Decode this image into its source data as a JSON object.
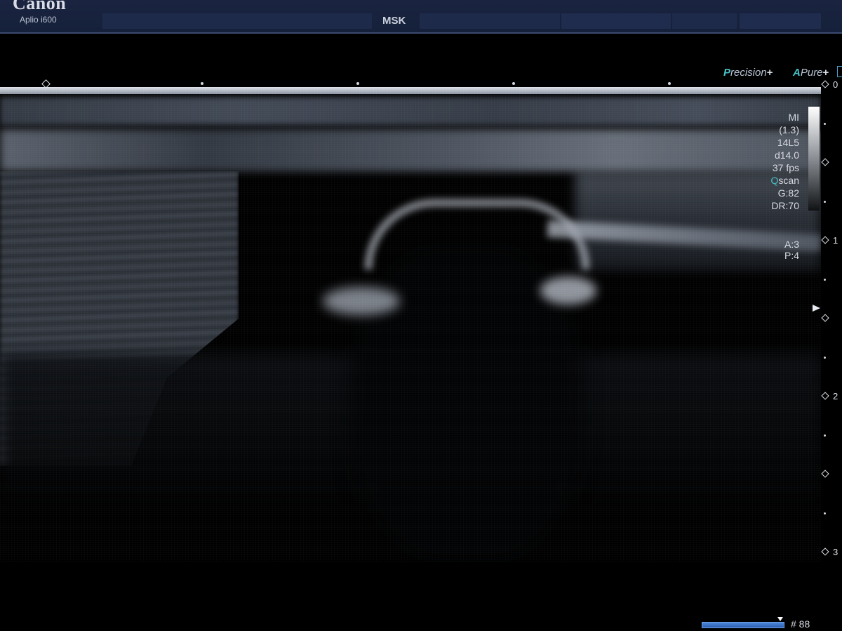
{
  "header": {
    "brand": "Canon",
    "model": "Aplio i600",
    "preset": "MSK"
  },
  "logos": {
    "precision_lead": "P",
    "precision_rest": "recision",
    "apure_lead": "A",
    "apure_rest": "Pure",
    "plus": "+"
  },
  "params": {
    "mi_label": "MI",
    "mi_value": "(1.3)",
    "probe": "14L5",
    "depth": "d14.0",
    "fps": "37 fps",
    "qscan_q": "Q",
    "qscan_rest": "scan",
    "gain": "G:82",
    "dynamic_range": "DR:70",
    "a": "A:3",
    "p": "P:4"
  },
  "depth_scale": {
    "labels": [
      "0",
      "1",
      "2",
      "3"
    ]
  },
  "cine": {
    "frame_label": "# 88",
    "progress": 1.0
  }
}
